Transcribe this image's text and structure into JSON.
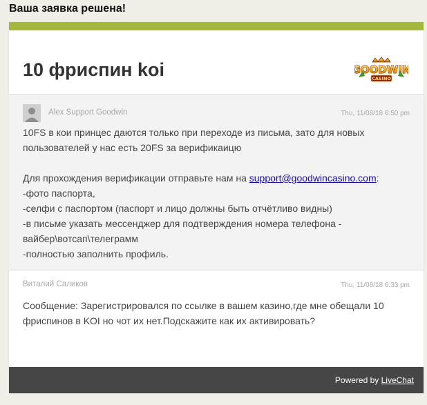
{
  "page": {
    "heading": "Ваша заявка решена!"
  },
  "ticket": {
    "title": "10 фриспин koi",
    "logo_text": "GOODWIN",
    "logo_sub": "CASINO"
  },
  "messages": [
    {
      "author": "Alex Support Goodwin",
      "timestamp": "Thu, 11/08/18 6:50 pm",
      "line1": "10FS в кои принцес даются только при переходе из письма, зато для новых пользователей у нас есть 20FS за верификаицю",
      "line2_prefix": "Для прохождения верификации отправьте нам на ",
      "email": "support@goodwincasino.com",
      "line2_suffix": ":",
      "items": [
        "-фото паспорта,",
        "-селфи с паспортом (паспорт и лицо должны быть отчётливо видны)",
        "-в письме указать мессенджер для подтверждения номера телефона - вайбер\\вотсап\\телеграмм",
        "-полностью заполнить профиль."
      ]
    },
    {
      "author": "Виталий Саликов",
      "timestamp": "Thu, 11/08/18 6:33 pm",
      "text": "Сообщение: Зарегистрировался по ссылке в вашем казино,где мне обещали 10 фриспинов в KOI но чот их нет.Подскажите как их активировать?"
    }
  ],
  "footer": {
    "powered_by": "Powered by ",
    "link_label": "LiveChat"
  },
  "colors": {
    "accent": "#a3b83f",
    "footer_bg": "#464646",
    "link": "#1a0dab"
  }
}
